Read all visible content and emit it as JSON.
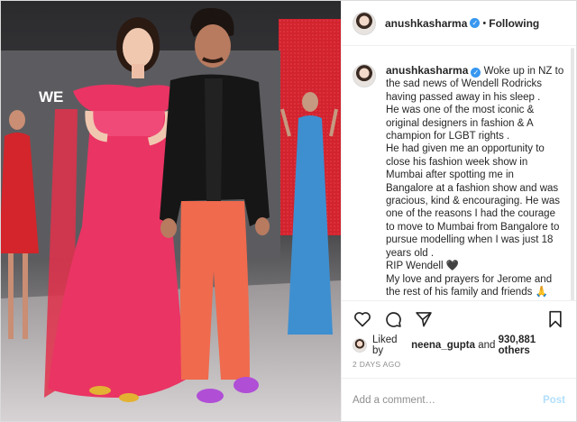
{
  "header": {
    "username": "anushkasharma",
    "verified_icon": "verified-badge-icon",
    "separator": "•",
    "follow_status": "Following"
  },
  "photo": {
    "backdrop_text": "WE"
  },
  "caption": {
    "username": "anushkasharma",
    "lines": [
      "Woke up in NZ to",
      "the sad news of Wendell Rodricks",
      "having passed away in his sleep .",
      "He was one of the most iconic &",
      "original designers in fashion & A",
      "champion for LGBT rights .",
      "He had given me an opportunity to",
      "close his fashion week show in",
      "Mumbai after spotting me in",
      "Bangalore at a fashion show and was",
      "gracious, kind & encouraging. He was",
      "one of the reasons I had the courage",
      "to move to Mumbai from Bangalore to",
      "pursue modelling when I was just 18",
      "years old .",
      "RIP Wendell 🖤",
      "My love and prayers for Jerome and",
      "the rest of his family and friends 🙏"
    ],
    "age": "2d"
  },
  "actions": {
    "icons": [
      "heart-icon",
      "comment-icon",
      "share-icon",
      "bookmark-icon"
    ]
  },
  "likes": {
    "prefix": "Liked by",
    "user": "neena_gupta",
    "middle": "and",
    "count": "930,881 others"
  },
  "date": "2 DAYS AGO",
  "comment_box": {
    "placeholder": "Add a comment…",
    "post_label": "Post"
  },
  "colors": {
    "accent": "#3897f0",
    "post_disabled": "#b2dffc",
    "muted_text": "#8e8e8e"
  }
}
